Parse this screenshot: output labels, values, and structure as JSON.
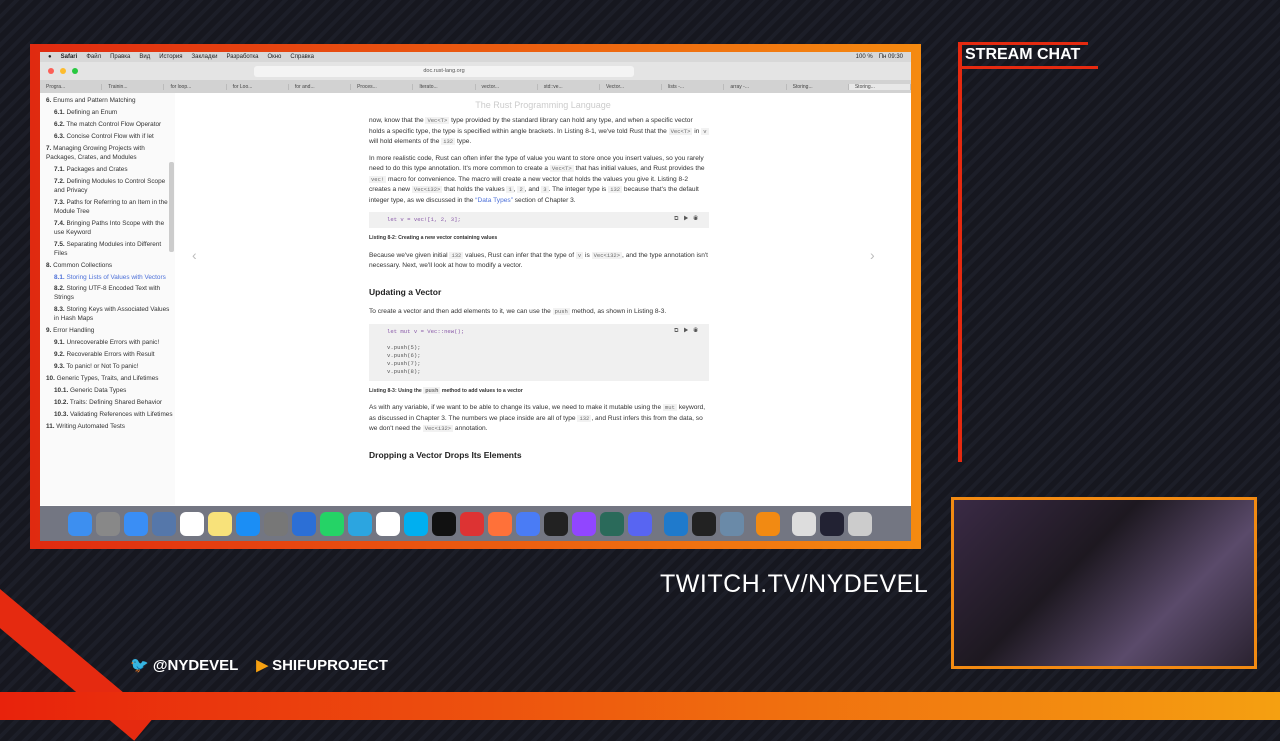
{
  "overlay": {
    "chat_title": "STREAM CHAT",
    "channel": "TWITCH.TV/NYDEVEL",
    "twitter": "@NYDEVEL",
    "youtube": "SHIFUPROJECT",
    "accent": "#e52a10",
    "accent2": "#f5a011"
  },
  "menubar": {
    "items": [
      "Safari",
      "Файл",
      "Правка",
      "Вид",
      "История",
      "Закладки",
      "Разработка",
      "Окно",
      "Справка"
    ],
    "status": "100 %",
    "clock": "Пн 09:30"
  },
  "browser": {
    "url": "doc.rust-lang.org",
    "tabs": [
      "Progra...",
      "Trainin...",
      "for loop...",
      "for Loo...",
      "for and...",
      "Proces...",
      "Iterato...",
      "vector...",
      "std::ve...",
      "Vector...",
      "lists -...",
      "array -...",
      "Storing...",
      "Storing..."
    ]
  },
  "page": {
    "title": "The Rust Programming Language"
  },
  "sidebar": {
    "items": [
      {
        "num": "6.",
        "label": "Enums and Pattern Matching",
        "level": 0
      },
      {
        "num": "6.1.",
        "label": "Defining an Enum",
        "level": 1
      },
      {
        "num": "6.2.",
        "label": "The match Control Flow Operator",
        "level": 1
      },
      {
        "num": "6.3.",
        "label": "Concise Control Flow with if let",
        "level": 1
      },
      {
        "num": "7.",
        "label": "Managing Growing Projects with Packages, Crates, and Modules",
        "level": 0
      },
      {
        "num": "7.1.",
        "label": "Packages and Crates",
        "level": 1
      },
      {
        "num": "7.2.",
        "label": "Defining Modules to Control Scope and Privacy",
        "level": 1
      },
      {
        "num": "7.3.",
        "label": "Paths for Referring to an Item in the Module Tree",
        "level": 1
      },
      {
        "num": "7.4.",
        "label": "Bringing Paths Into Scope with the use Keyword",
        "level": 1
      },
      {
        "num": "7.5.",
        "label": "Separating Modules into Different Files",
        "level": 1
      },
      {
        "num": "8.",
        "label": "Common Collections",
        "level": 0
      },
      {
        "num": "8.1.",
        "label": "Storing Lists of Values with Vectors",
        "level": 1,
        "active": true
      },
      {
        "num": "8.2.",
        "label": "Storing UTF-8 Encoded Text with Strings",
        "level": 1
      },
      {
        "num": "8.3.",
        "label": "Storing Keys with Associated Values in Hash Maps",
        "level": 1
      },
      {
        "num": "9.",
        "label": "Error Handling",
        "level": 0
      },
      {
        "num": "9.1.",
        "label": "Unrecoverable Errors with panic!",
        "level": 1
      },
      {
        "num": "9.2.",
        "label": "Recoverable Errors with Result",
        "level": 1
      },
      {
        "num": "9.3.",
        "label": "To panic! or Not To panic!",
        "level": 1
      },
      {
        "num": "10.",
        "label": "Generic Types, Traits, and Lifetimes",
        "level": 0
      },
      {
        "num": "10.1.",
        "label": "Generic Data Types",
        "level": 1
      },
      {
        "num": "10.2.",
        "label": "Traits: Defining Shared Behavior",
        "level": 1
      },
      {
        "num": "10.3.",
        "label": "Validating References with Lifetimes",
        "level": 1
      },
      {
        "num": "11.",
        "label": "Writing Automated Tests",
        "level": 0
      }
    ]
  },
  "content": {
    "p1": [
      "now, know that the ",
      "Vec<T>",
      " type provided by the standard library can hold any type, and when a specific vector holds a specific type, the type is specified within angle brackets. In Listing 8-1, we've told Rust that the ",
      "Vec<T>",
      " in ",
      "v",
      " will hold elements of the ",
      "i32",
      " type."
    ],
    "p2": [
      "In more realistic code, Rust can often infer the type of value you want to store once you insert values, so you rarely need to do this type annotation. It's more common to create a ",
      "Vec<T>",
      " that has initial values, and Rust provides the ",
      "vec!",
      " macro for convenience. The macro will create a new vector that holds the values you give it. Listing 8-2 creates a new ",
      "Vec<i32>",
      " that holds the values ",
      "1",
      ", ",
      "2",
      ", and ",
      "3",
      ". The integer type is ",
      "i32",
      " because that's the default integer type, as we discussed in the "
    ],
    "p2_link": "“Data Types”",
    "p2_end": " section of Chapter 3.",
    "code1": "let v = vec![1, 2, 3];",
    "caption1": "Listing 8-2: Creating a new vector containing values",
    "p3": [
      "Because we've given initial ",
      "i32",
      " values, Rust can infer that the type of ",
      "v",
      " is ",
      "Vec<i32>",
      ", and the type annotation isn't necessary. Next, we'll look at how to modify a vector."
    ],
    "h_update": "Updating a Vector",
    "p4": [
      "To create a vector and then add elements to it, we can use the ",
      "push",
      " method, as shown in Listing 8-3."
    ],
    "code2": [
      "let mut v = Vec::new();",
      "",
      "v.push(5);",
      "v.push(6);",
      "v.push(7);",
      "v.push(8);"
    ],
    "caption2": [
      "Listing 8-3: Using the ",
      "push",
      " method to add values to a vector"
    ],
    "p5": [
      "As with any variable, if we want to be able to change its value, we need to make it mutable using the ",
      "mut",
      " keyword, as discussed in Chapter 3. The numbers we place inside are all of type ",
      "i32",
      ", and Rust infers this from the data, so we don't need the ",
      "Vec<i32>",
      " annotation."
    ],
    "h_drop": "Dropping a Vector Drops Its Elements"
  },
  "dock": {
    "apps": [
      "finder",
      "launchpad",
      "safari",
      "preview",
      "calendar",
      "notes",
      "app-store",
      "system-preferences",
      "1password",
      "whatsapp",
      "telegram",
      "chrome",
      "skype",
      "terminal",
      "parallels",
      "firefox",
      "tasks",
      "obs",
      "twitch",
      "chatterino",
      "discord",
      "vscode",
      "activity-monitor",
      "image-capture",
      "vpn",
      "documents",
      "screen",
      "trash"
    ],
    "colors": [
      "#3d8ff0",
      "#888",
      "#3a8ef5",
      "#5577aa",
      "#fff",
      "#f8e27a",
      "#1b8ef5",
      "#777",
      "#2c6fd6",
      "#25d366",
      "#2ca5e0",
      "#fff",
      "#00aff0",
      "#111",
      "#d33",
      "#ff7139",
      "#4a7cf5",
      "#222",
      "#9146ff",
      "#2a6a5a",
      "#5865f2",
      "#1f7acc",
      "#222",
      "#6a8aa8",
      "#f28a12",
      "#ddd",
      "#223",
      "#ccc"
    ]
  }
}
